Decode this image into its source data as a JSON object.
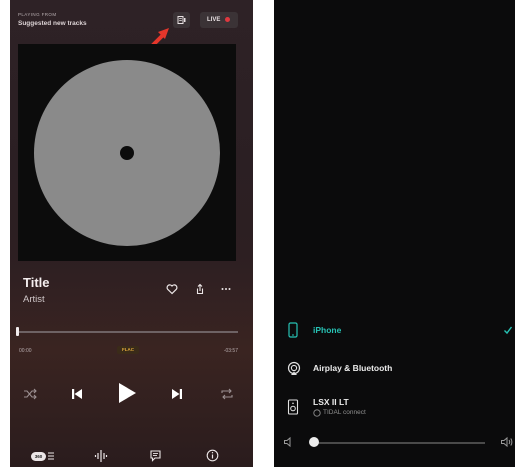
{
  "left_screen": {
    "header": {
      "context_label": "PLAYING FROM",
      "source": "Suggested new tracks",
      "live_label": "LIVE"
    },
    "track": {
      "title": "Title",
      "artist": "Artist"
    },
    "progress": {
      "elapsed": "00:00",
      "remaining": "-03:57",
      "fraction": 0.0,
      "quality_badge": "FLAC"
    },
    "bottom_bar": {
      "mode_label": "360"
    }
  },
  "right_screen": {
    "devices": [
      {
        "label": "iPhone",
        "selected": true,
        "icon": "phone-icon"
      },
      {
        "label": "Airplay & Bluetooth",
        "selected": false,
        "icon": "airplay-icon"
      },
      {
        "label": "LSX II LT",
        "sublabel": "TIDAL connect",
        "selected": false,
        "icon": "speaker-icon"
      }
    ],
    "volume": {
      "fraction": 0.0
    }
  },
  "colors": {
    "accent": "#27c2b4",
    "live_dot": "#e0383f",
    "badge": "#e3aa3c",
    "annotation_arrow": "#e5362b"
  }
}
